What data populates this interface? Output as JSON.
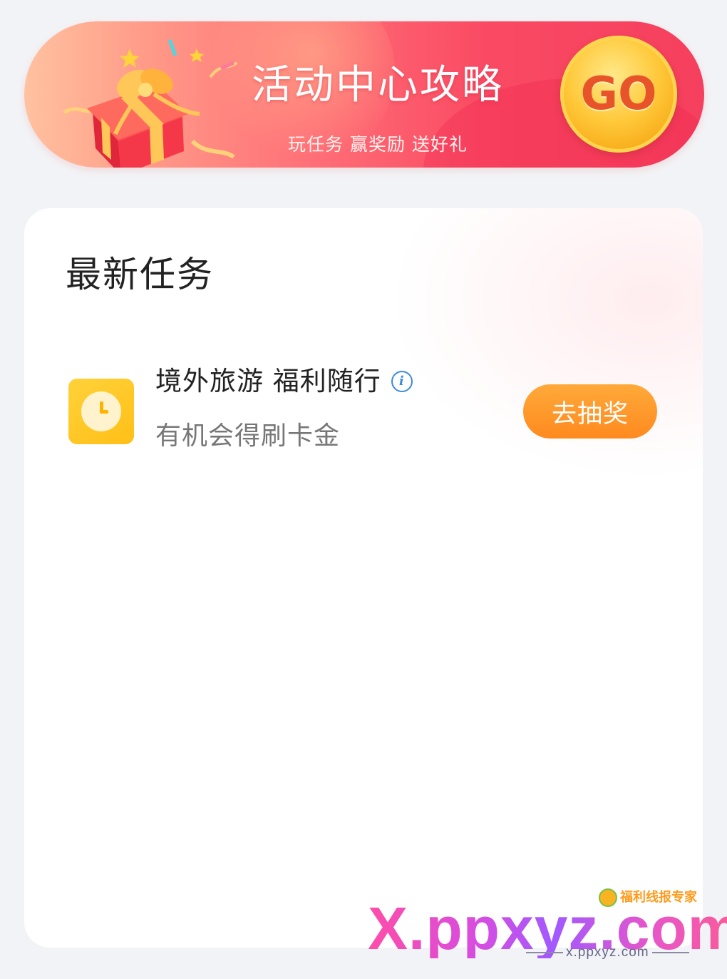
{
  "banner": {
    "title": "活动中心攻略",
    "subtitle": "玩任务 赢奖励 送好礼",
    "go_label": "GO",
    "gift_icon": "gift-box-icon"
  },
  "section": {
    "title": "最新任务"
  },
  "tasks": [
    {
      "icon": "clock-icon",
      "title": "境外旅游 福利随行",
      "info_icon": "info-icon",
      "info_glyph": "i",
      "subtitle": "有机会得刷卡金",
      "button_label": "去抽奖"
    }
  ],
  "watermark": {
    "text": "X.ppxyz.com",
    "brand": "福利线报专家",
    "url": "x.ppxyz.com"
  },
  "colors": {
    "banner_red": "#f53f5e",
    "go_gold": "#ffc93b",
    "button_orange": "#ff8a1f",
    "task_icon_yellow": "#ffc21c",
    "info_blue": "#3b8be0"
  }
}
